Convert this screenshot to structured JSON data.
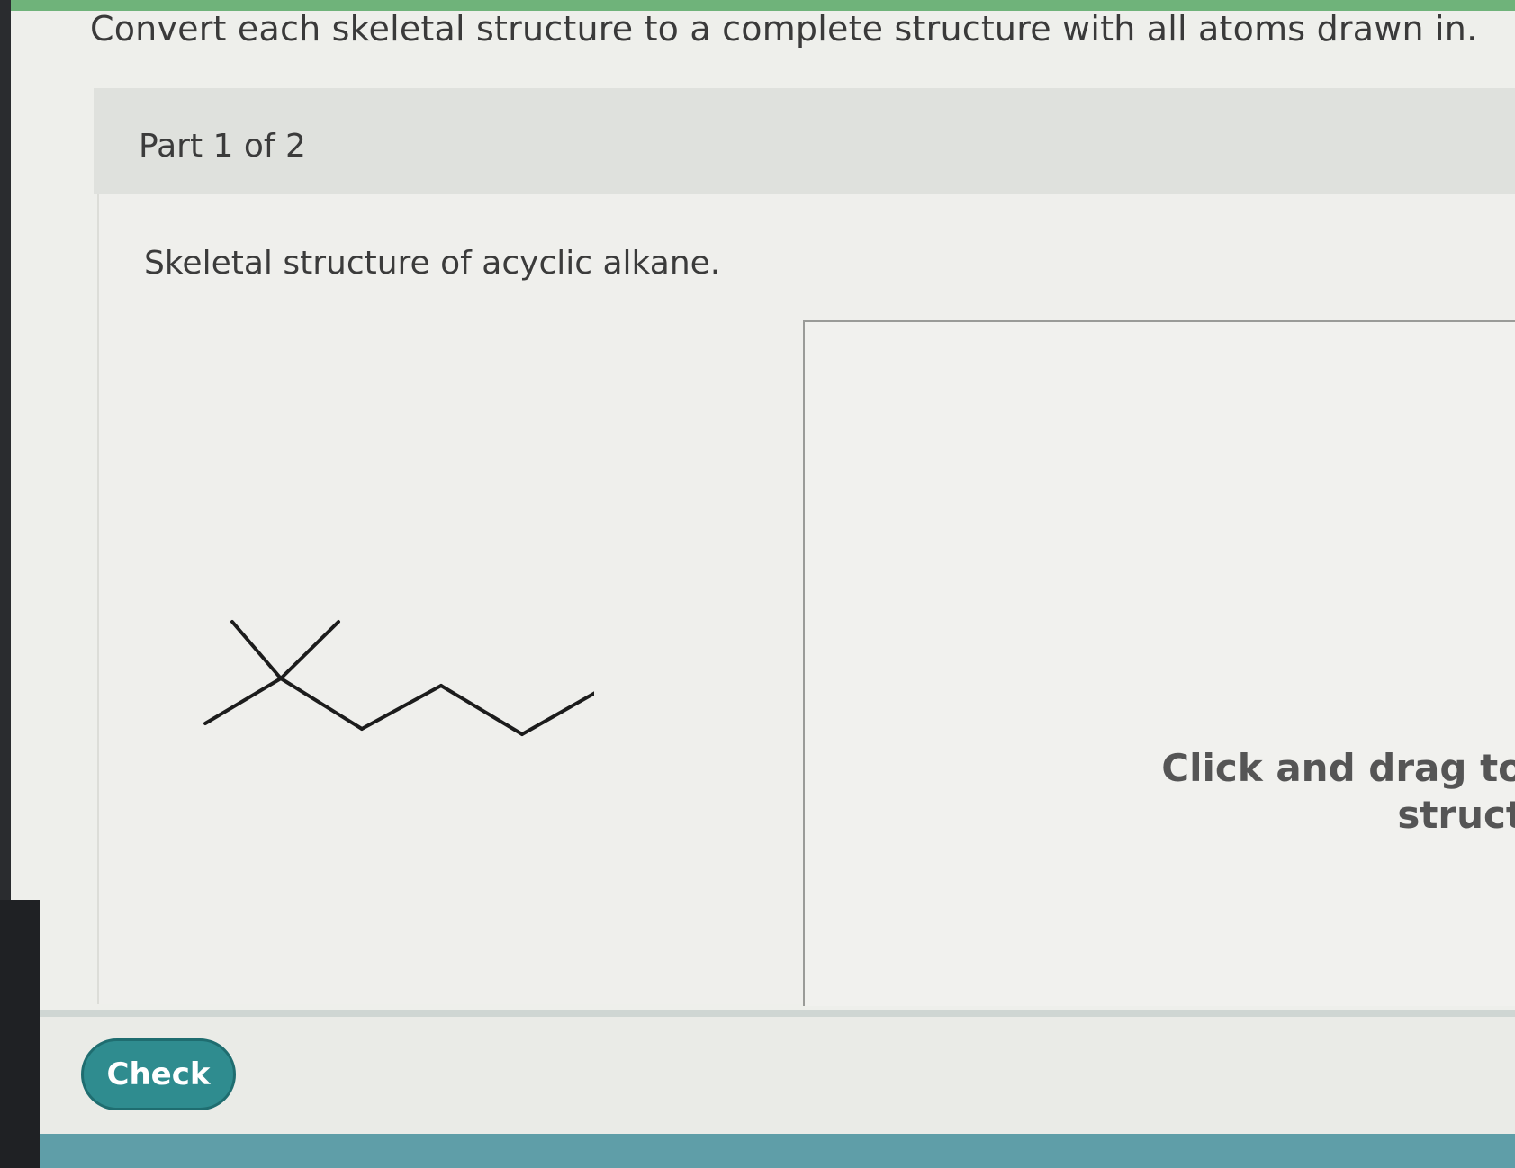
{
  "page": {
    "instruction": "Convert each skeletal structure to a complete structure with all atoms drawn in."
  },
  "part": {
    "label": "Part 1 of 2"
  },
  "question": {
    "text": "Skeletal structure of acyclic alkane."
  },
  "canvas": {
    "hint_line1": "Click and drag to",
    "hint_line2": "struct"
  },
  "footer": {
    "check_label": "Check"
  },
  "colors": {
    "accent": "#2f8c8f",
    "header_bg": "#dfe1dd",
    "top_bar": "#6fb37a",
    "bottom_bar": "#5f9ea8"
  }
}
